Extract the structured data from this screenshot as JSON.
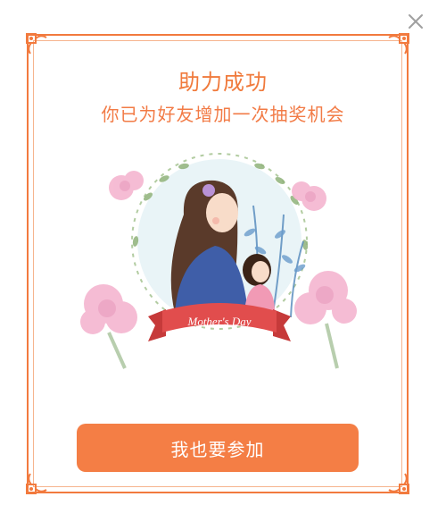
{
  "dialog": {
    "title": "助力成功",
    "subtitle": "你已为好友增加一次抽奖机会",
    "banner_text": "Mother's Day",
    "cta_label": "我也要参加"
  },
  "colors": {
    "accent": "#f47e45",
    "title": "#f07a3c",
    "border": "#f27a3e",
    "close_icon": "#9a9a9a"
  },
  "icons": {
    "close": "close-icon",
    "corner": "ornament-corner-icon"
  }
}
